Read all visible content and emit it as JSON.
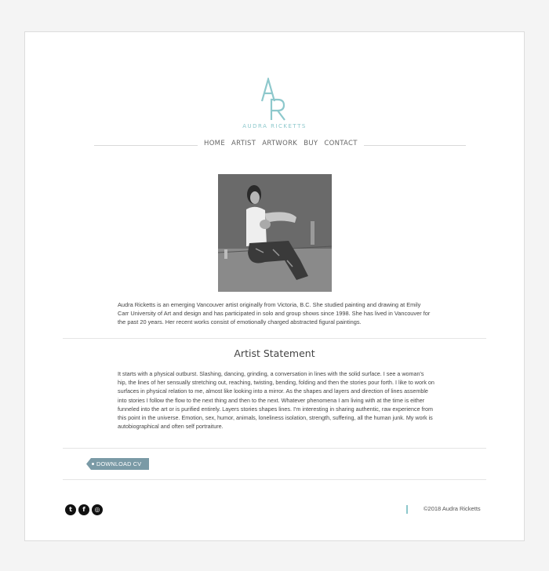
{
  "brand": {
    "monogram": "AR",
    "name": "AUDRA RICKETTS",
    "accent_color": "#8dc8cc"
  },
  "nav": {
    "items": [
      {
        "label": "HOME"
      },
      {
        "label": "ARTIST"
      },
      {
        "label": "ARTWORK"
      },
      {
        "label": "BUY"
      },
      {
        "label": "CONTACT"
      }
    ]
  },
  "bio": {
    "text": "Audra Ricketts is an emerging Vancouver artist originally from Victoria, B.C. She studied painting and drawing at Emily Carr University of Art and design and has participated in solo and group shows since 1998. She has lived in Vancouver for the past 20 years. Her recent works consist of emotionally charged abstracted figural paintings."
  },
  "statement": {
    "title": "Artist Statement",
    "text": "It starts with a physical outburst. Slashing, dancing, grinding, a conversation in lines with the solid surface. I see a woman's hip, the lines of her sensually stretching out, reaching, twisting, bending, folding and then the stories pour forth. I like to work on surfaces in physical relation to me, almost like looking into a mirror. As the shapes and layers and direction of lines assemble into stories I follow the flow to the next thing and then to the next. Whatever phenomena I am living with at the time is either funneled into the art or is purified entirely. Layers stories shapes lines. I'm interesting in sharing authentic, raw experience from this point in the universe. Emotion, sex, humor, animals, loneliness isolation, strength, suffering, all the human junk. My work is autobiographical and often self portraiture."
  },
  "cv_button": {
    "label": "DOWNLOAD CV",
    "color": "#7a9aa6"
  },
  "footer": {
    "social": [
      {
        "icon": "twitter-icon",
        "glyph": "t"
      },
      {
        "icon": "facebook-icon",
        "glyph": "f"
      },
      {
        "icon": "instagram-icon",
        "glyph": "◎"
      }
    ],
    "copyright": "©2018 Audra Ricketts"
  }
}
